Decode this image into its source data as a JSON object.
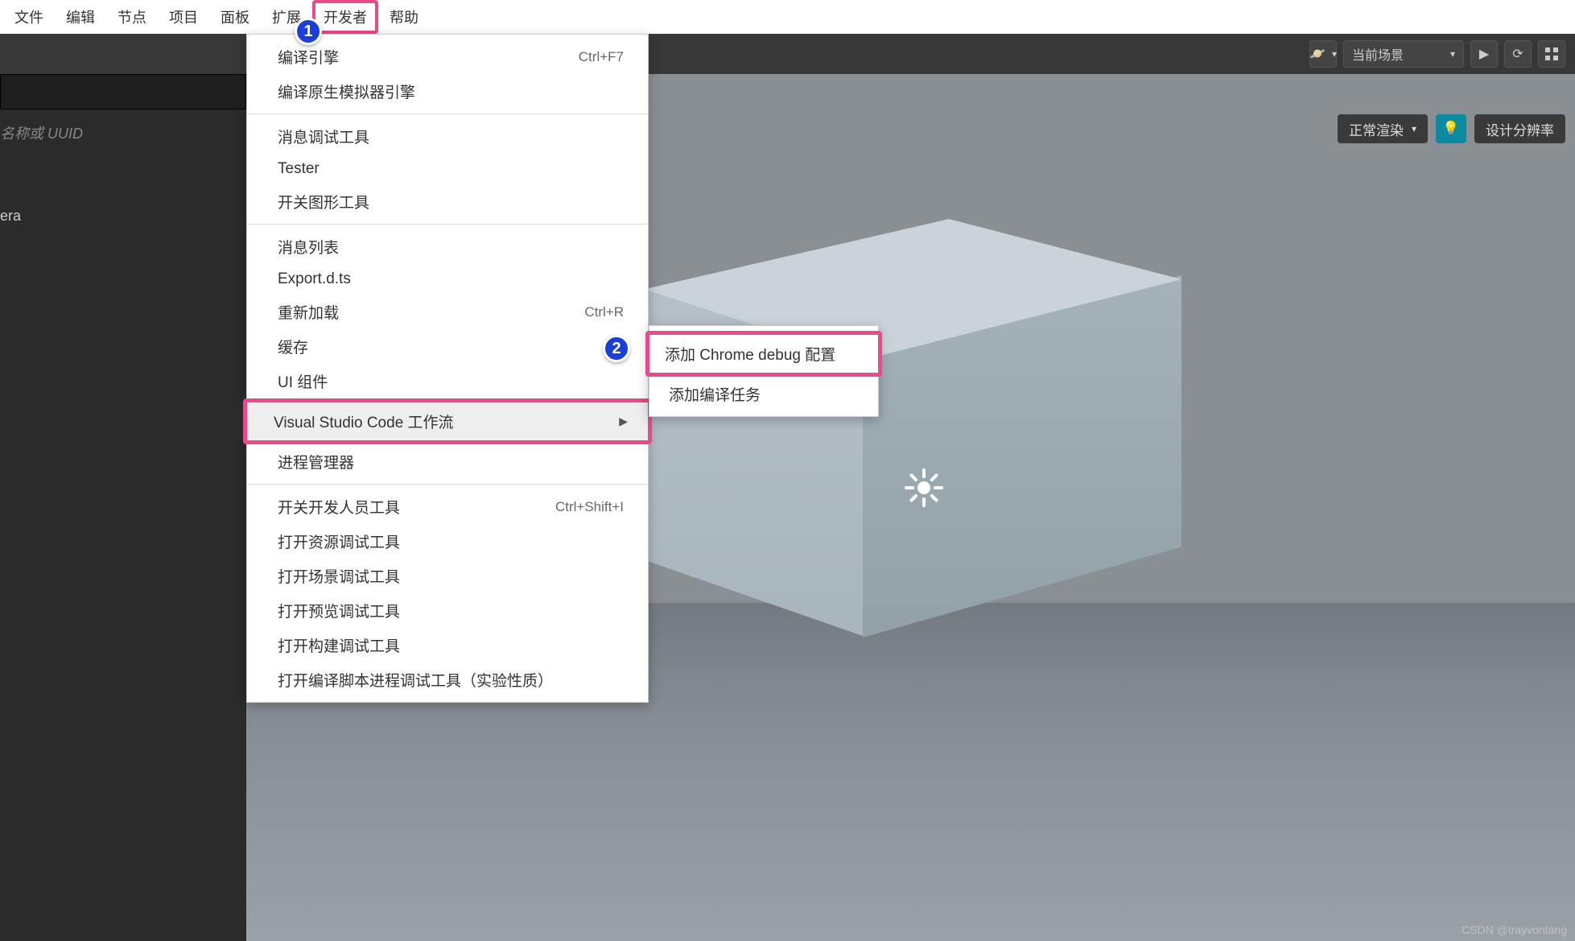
{
  "menubar": {
    "items": [
      "文件",
      "编辑",
      "节点",
      "项目",
      "面板",
      "扩展",
      "开发者",
      "帮助"
    ],
    "highlighted_index": 6
  },
  "toolbar": {
    "scene_selector": "当前场景",
    "planet_icon": "planet",
    "play_icon": "play",
    "reload_icon": "reload",
    "grid_icon": "grid"
  },
  "leftpanel": {
    "hint": "名称或 UUID",
    "items": [
      "era",
      ""
    ]
  },
  "viewport": {
    "render_mode": "正常渲染",
    "design_res": "设计分辨率"
  },
  "dropdown": {
    "groups": [
      [
        {
          "label": "编译引擎",
          "shortcut": "Ctrl+F7"
        },
        {
          "label": "编译原生模拟器引擎"
        }
      ],
      [
        {
          "label": "消息调试工具"
        },
        {
          "label": "Tester"
        },
        {
          "label": "开关图形工具"
        }
      ],
      [
        {
          "label": "消息列表"
        },
        {
          "label": "Export.d.ts"
        },
        {
          "label": "重新加载",
          "shortcut": "Ctrl+R"
        },
        {
          "label": "缓存",
          "submenu": true
        },
        {
          "label": "UI 组件"
        },
        {
          "label": "Visual Studio Code 工作流",
          "submenu": true,
          "highlight": true
        },
        {
          "label": "进程管理器"
        }
      ],
      [
        {
          "label": "开关开发人员工具",
          "shortcut": "Ctrl+Shift+I"
        },
        {
          "label": "打开资源调试工具"
        },
        {
          "label": "打开场景调试工具"
        },
        {
          "label": "打开预览调试工具"
        },
        {
          "label": "打开构建调试工具"
        },
        {
          "label": "打开编译脚本进程调试工具（实验性质）"
        }
      ]
    ]
  },
  "submenu": {
    "items": [
      {
        "label": "添加 Chrome debug 配置",
        "highlight": true
      },
      {
        "label": "添加编译任务"
      }
    ]
  },
  "annotations": {
    "badge1": "1",
    "badge2": "2"
  },
  "watermark": "CSDN @trayvontang"
}
